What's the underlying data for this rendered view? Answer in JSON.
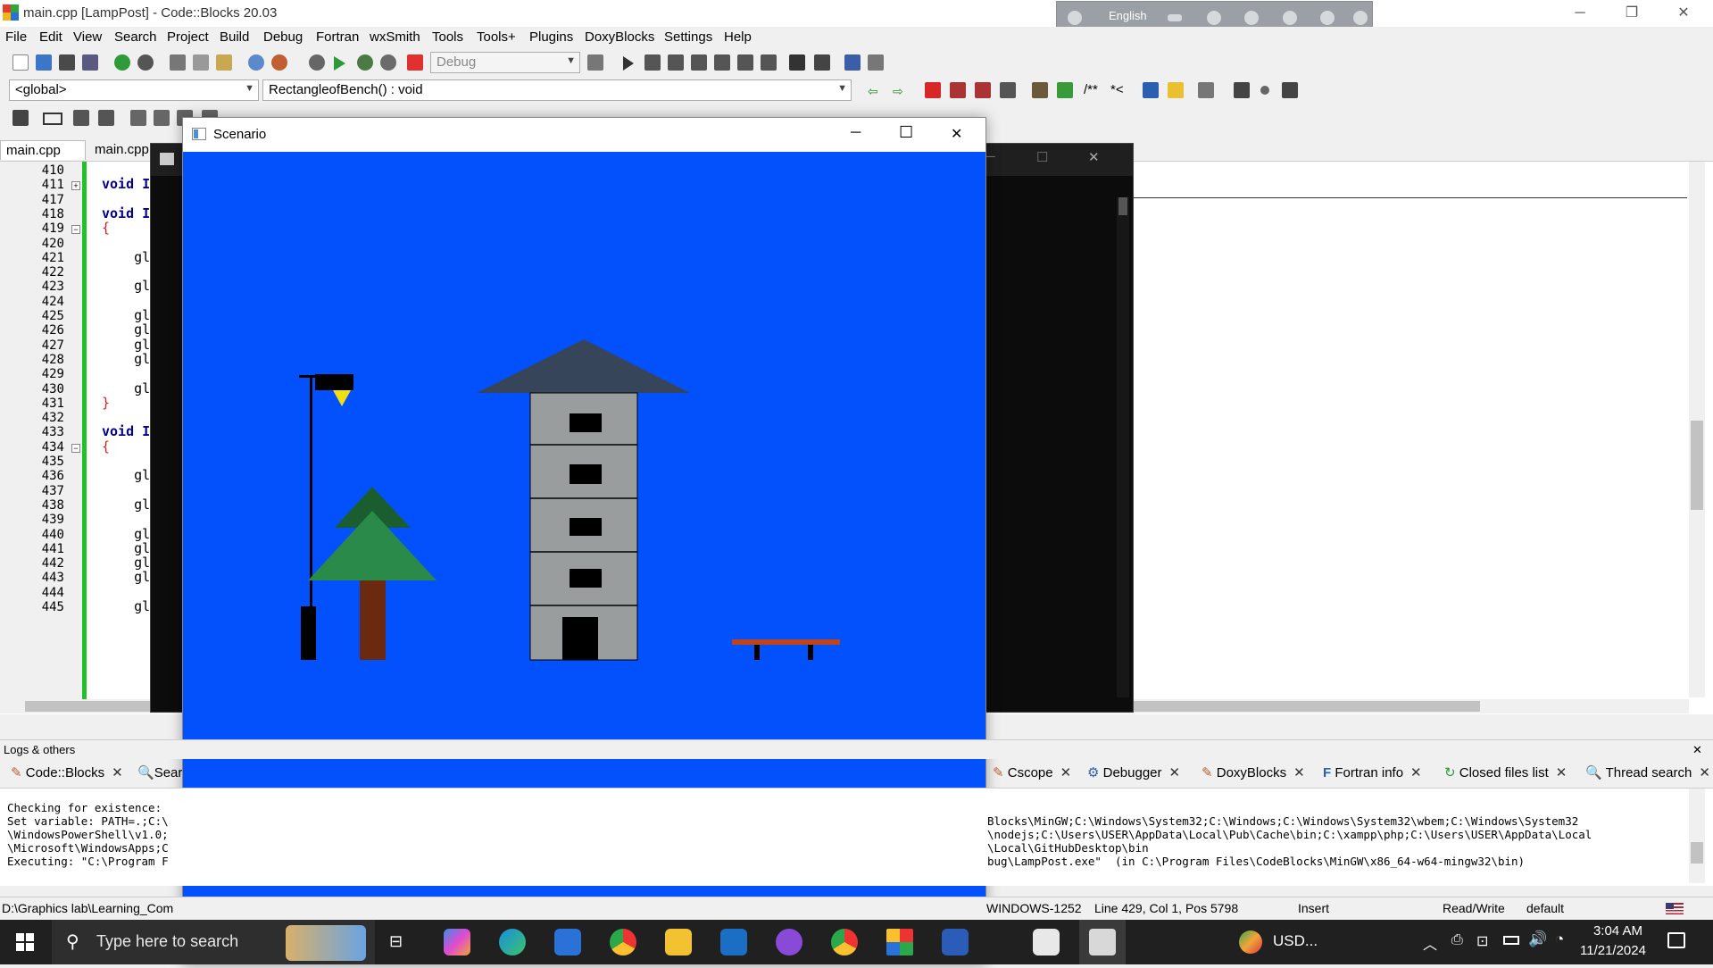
{
  "window": {
    "title": "main.cpp [LampPost] - Code::Blocks 20.03",
    "minimize": "─",
    "restore": "❐",
    "close": "✕"
  },
  "language_bar": {
    "language": "English"
  },
  "menu": [
    "File",
    "Edit",
    "View",
    "Search",
    "Project",
    "Build",
    "Debug",
    "Fortran",
    "wxSmith",
    "Tools",
    "Tools+",
    "Plugins",
    "DoxyBlocks",
    "Settings",
    "Help"
  ],
  "toolbar": {
    "build_target": "Debug",
    "scope": "<global>",
    "function": "RectangleofBench() : void",
    "comment_1": "/**",
    "comment_2": "*<"
  },
  "tabs": [
    {
      "label": "main.cpp",
      "close": "✕"
    },
    {
      "label": "main.cpp"
    }
  ],
  "editor": {
    "lines": [
      "410",
      "411",
      "417",
      "418",
      "419",
      "420",
      "421",
      "422",
      "423",
      "424",
      "425",
      "426",
      "427",
      "428",
      "429",
      "430",
      "431",
      "432",
      "433",
      "434",
      "435",
      "436",
      "437",
      "438",
      "439",
      "440",
      "441",
      "442",
      "443",
      "444",
      "445"
    ],
    "code": [
      {
        "line": 1,
        "text": "void I",
        "kw": true
      },
      {
        "line": 3,
        "text": "void I",
        "kw": true
      },
      {
        "line": 4,
        "text": "{",
        "brace": true
      },
      {
        "line": 6,
        "text": "    gl"
      },
      {
        "line": 8,
        "text": "    gl"
      },
      {
        "line": 10,
        "text": "    gl"
      },
      {
        "line": 11,
        "text": "    gl"
      },
      {
        "line": 12,
        "text": "    gl"
      },
      {
        "line": 13,
        "text": "    gl"
      },
      {
        "line": 15,
        "text": "    gl"
      },
      {
        "line": 16,
        "text": "}",
        "brace": true
      },
      {
        "line": 18,
        "text": "void I",
        "kw": true
      },
      {
        "line": 19,
        "text": "{",
        "brace": true
      },
      {
        "line": 21,
        "text": "    gl"
      },
      {
        "line": 23,
        "text": "    gl"
      },
      {
        "line": 25,
        "text": "    gl"
      },
      {
        "line": 26,
        "text": "    gl"
      },
      {
        "line": 27,
        "text": "    gl"
      },
      {
        "line": 28,
        "text": "    gl"
      },
      {
        "line": 30,
        "text": "    gl"
      }
    ]
  },
  "scenario": {
    "title": "Scenario",
    "minimize": "─",
    "maximize": "☐",
    "close": "✕",
    "background": "#0251fc",
    "colors": {
      "roof": "#364559",
      "tower": "#9a9d9e",
      "window": "#000000",
      "tree_top": "#1a5e30",
      "tree_bottom": "#2a8a4a",
      "trunk": "#6b2a10",
      "bench": "#c0441a",
      "lamp_head": "#000000",
      "lamp_light": "#f0e010"
    }
  },
  "logs": {
    "header": "Logs & others",
    "close": "✕",
    "tabs_left": [
      {
        "label": "Code::Blocks",
        "close": "✕"
      },
      {
        "label": "Sear"
      }
    ],
    "tabs_right": [
      {
        "label": "Cscope",
        "close": "✕"
      },
      {
        "label": "Debugger",
        "close": "✕"
      },
      {
        "label": "DoxyBlocks",
        "close": "✕"
      },
      {
        "label": "Fortran info",
        "close": "✕"
      },
      {
        "label": "Closed files list",
        "close": "✕"
      },
      {
        "label": "Thread search",
        "close": "✕"
      }
    ],
    "lines_left": [
      "Checking for existence: ",
      "Set variable: PATH=.;C:\\",
      "\\WindowsPowerShell\\v1.0;",
      "\\Microsoft\\WindowsApps;C",
      "Executing: \"C:\\Program F"
    ],
    "lines_right": [
      "Blocks\\MinGW;C:\\Windows\\System32;C:\\Windows;C:\\Windows\\System32\\wbem;C:\\Windows\\System32",
      "\\nodejs;C:\\Users\\USER\\AppData\\Local\\Pub\\Cache\\bin;C:\\xampp\\php;C:\\Users\\USER\\AppData\\Local",
      "\\Local\\GitHubDesktop\\bin",
      "bug\\LampPost.exe\"  (in C:\\Program Files\\CodeBlocks\\MinGW\\x86_64-w64-mingw32\\bin)"
    ]
  },
  "status": {
    "path": "D:\\Graphics lab\\Learning_Com",
    "encoding": "WINDOWS-1252",
    "position": "Line 429, Col 1, Pos 5798",
    "mode": "Insert",
    "access": "Read/Write",
    "lang": "default"
  },
  "taskbar": {
    "search_placeholder": "Type here to search",
    "weather": "USD...",
    "time": "3:04 AM",
    "date": "11/21/2024"
  }
}
